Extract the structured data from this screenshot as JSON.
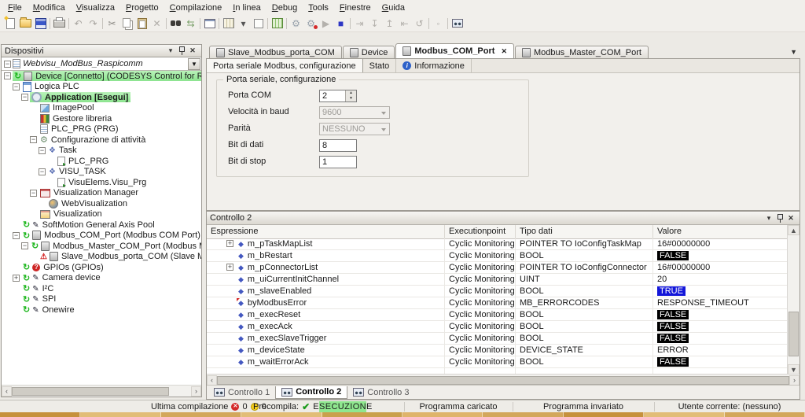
{
  "menu": {
    "items": [
      "File",
      "Modifica",
      "Visualizza",
      "Progetto",
      "Compilazione",
      "In linea",
      "Debug",
      "Tools",
      "Finestre",
      "Guida"
    ]
  },
  "toolbar": {
    "icons": [
      "new-file-icon",
      "open-folder-icon",
      "save-icon",
      "|",
      "print-icon",
      "|",
      "undo-icon",
      "redo-icon",
      "|",
      "cut-icon",
      "copy-icon",
      "paste-icon",
      "delete-icon",
      "|",
      "find-icon",
      "search-replace-icon",
      "|",
      "project-window-icon",
      "|",
      "visualization-grid-icon",
      "dropdown-arrow-icon",
      "new-object-icon",
      "|",
      "build-icon",
      "|",
      "login-icon",
      "logout-icon",
      "run-icon",
      "stop-icon",
      "|",
      "step-over-icon",
      "step-into-icon",
      "step-out-icon",
      "step-return-icon",
      "reset-icon",
      "|",
      "breakpoint-icon",
      "|",
      "watch-list-icon"
    ]
  },
  "devices_panel": {
    "title": "Dispositivi",
    "root": {
      "label": "Webvisu_ModBus_Raspicomm"
    },
    "tree": [
      {
        "label": "Device [Connetto] (CODESYS Control for Raspberry Pi)",
        "level": 1,
        "expander": "minus",
        "icons": [
          "refresh-icon",
          "device-icon"
        ],
        "highlight": true,
        "bold": false
      },
      {
        "label": "Logica PLC",
        "level": 2,
        "expander": "minus",
        "icons": [
          "plc-logic-icon"
        ]
      },
      {
        "label": "Application [Esegui]",
        "level": 3,
        "expander": "minus",
        "icons": [
          "application-icon"
        ],
        "highlight": true,
        "bold": true
      },
      {
        "label": "ImagePool",
        "level": 4,
        "expander": null,
        "icons": [
          "image-pool-icon"
        ]
      },
      {
        "label": "Gestore libreria",
        "level": 4,
        "expander": null,
        "icons": [
          "library-icon"
        ]
      },
      {
        "label": "PLC_PRG (PRG)",
        "level": 4,
        "expander": null,
        "icons": [
          "pou-icon"
        ]
      },
      {
        "label": "Configurazione di attività",
        "level": 4,
        "expander": "minus",
        "icons": [
          "task-config-icon"
        ]
      },
      {
        "label": "Task",
        "level": 5,
        "expander": "minus",
        "icons": [
          "task-icon"
        ]
      },
      {
        "label": "PLC_PRG",
        "level": 6,
        "expander": null,
        "icons": [
          "pou-call-icon"
        ]
      },
      {
        "label": "VISU_TASK",
        "level": 5,
        "expander": "minus",
        "icons": [
          "task-icon"
        ]
      },
      {
        "label": "VisuElems.Visu_Prg",
        "level": 6,
        "expander": null,
        "icons": [
          "pou-call-icon"
        ]
      },
      {
        "label": "Visualization Manager",
        "level": 4,
        "expander": "minus",
        "icons": [
          "visu-manager-icon"
        ]
      },
      {
        "label": "WebVisualization",
        "level": 5,
        "expander": null,
        "icons": [
          "webvisu-icon"
        ]
      },
      {
        "label": "Visualization",
        "level": 4,
        "expander": null,
        "icons": [
          "visu-icon"
        ]
      },
      {
        "label": "SoftMotion General Axis Pool",
        "level": 2,
        "expander": null,
        "icons": [
          "refresh-icon",
          "driver-icon"
        ]
      },
      {
        "label": "Modbus_COM_Port (Modbus COM Port)",
        "level": 2,
        "expander": "minus",
        "icons": [
          "refresh-icon",
          "device-icon"
        ]
      },
      {
        "label": "Modbus_Master_COM_Port (Modbus Master, C",
        "level": 3,
        "expander": "minus",
        "icons": [
          "refresh-icon",
          "device-icon"
        ]
      },
      {
        "label": "Slave_Modbus_porta_COM (Slave Modbus,",
        "level": 4,
        "expander": null,
        "icons": [
          "warning-icon",
          "device-icon"
        ]
      },
      {
        "label": "GPIOs (GPIOs)",
        "level": 2,
        "expander": null,
        "icons": [
          "refresh-icon",
          "gpio-error-icon"
        ]
      },
      {
        "label": "Camera device",
        "level": 2,
        "expander": "plus",
        "icons": [
          "refresh-icon",
          "driver-icon"
        ]
      },
      {
        "label": "I²C",
        "level": 2,
        "expander": null,
        "icons": [
          "refresh-icon",
          "driver-icon"
        ]
      },
      {
        "label": "SPI",
        "level": 2,
        "expander": null,
        "icons": [
          "refresh-icon",
          "driver-icon"
        ]
      },
      {
        "label": "Onewire",
        "level": 2,
        "expander": null,
        "icons": [
          "refresh-icon",
          "driver-icon"
        ]
      }
    ]
  },
  "editor": {
    "doc_tabs": [
      {
        "label": "Slave_Modbus_porta_COM",
        "active": false,
        "closable": false
      },
      {
        "label": "Device",
        "active": false,
        "closable": false
      },
      {
        "label": "Modbus_COM_Port",
        "active": true,
        "closable": true
      },
      {
        "label": "Modbus_Master_COM_Port",
        "active": false,
        "closable": false
      }
    ],
    "sub_tabs": [
      {
        "label": "Porta seriale Modbus, configurazione",
        "active": true,
        "icon": null
      },
      {
        "label": "Stato",
        "active": false,
        "icon": null
      },
      {
        "label": "Informazione",
        "active": false,
        "icon": "info-icon"
      }
    ],
    "form": {
      "legend": "Porta seriale, configurazione",
      "fields": [
        {
          "label": "Porta COM",
          "value": "2",
          "control": "spinner",
          "enabled": true
        },
        {
          "label": "Velocità in baud",
          "value": "9600",
          "control": "select",
          "enabled": false
        },
        {
          "label": "Parità",
          "value": "NESSUNO",
          "control": "select",
          "enabled": false
        },
        {
          "label": "Bit di dati",
          "value": "8",
          "control": "input",
          "enabled": true
        },
        {
          "label": "Bit di stop",
          "value": "1",
          "control": "input",
          "enabled": true
        }
      ]
    }
  },
  "watch_panel": {
    "title": "Controllo 2",
    "columns": [
      "Espressione",
      "Executionpoint",
      "Tipo dati",
      "Valore"
    ],
    "rows": [
      {
        "expression": "m_pTaskMapList",
        "executionpoint": "Cyclic Monitoring",
        "type": "POINTER TO IoConfigTaskMap",
        "value": "16#00000000",
        "value_style": "plain",
        "expandable": true,
        "flagged": false
      },
      {
        "expression": "m_bRestart",
        "executionpoint": "Cyclic Monitoring",
        "type": "BOOL",
        "value": "FALSE",
        "value_style": "false",
        "expandable": false,
        "flagged": false
      },
      {
        "expression": "m_pConnectorList",
        "executionpoint": "Cyclic Monitoring",
        "type": "POINTER TO IoConfigConnector",
        "value": "16#00000000",
        "value_style": "plain",
        "expandable": true,
        "flagged": false
      },
      {
        "expression": "m_uiCurrentInitChannel",
        "executionpoint": "Cyclic Monitoring",
        "type": "UINT",
        "value": "20",
        "value_style": "plain",
        "expandable": false,
        "flagged": false
      },
      {
        "expression": "m_slaveEnabled",
        "executionpoint": "Cyclic Monitoring",
        "type": "BOOL",
        "value": "TRUE",
        "value_style": "true",
        "expandable": false,
        "flagged": false
      },
      {
        "expression": "byModbusError",
        "executionpoint": "Cyclic Monitoring",
        "type": "MB_ERRORCODES",
        "value": "RESPONSE_TIMEOUT",
        "value_style": "plain",
        "expandable": false,
        "flagged": true
      },
      {
        "expression": "m_execReset",
        "executionpoint": "Cyclic Monitoring",
        "type": "BOOL",
        "value": "FALSE",
        "value_style": "false",
        "expandable": false,
        "flagged": false
      },
      {
        "expression": "m_execAck",
        "executionpoint": "Cyclic Monitoring",
        "type": "BOOL",
        "value": "FALSE",
        "value_style": "false",
        "expandable": false,
        "flagged": false
      },
      {
        "expression": "m_execSlaveTrigger",
        "executionpoint": "Cyclic Monitoring",
        "type": "BOOL",
        "value": "FALSE",
        "value_style": "false",
        "expandable": false,
        "flagged": false
      },
      {
        "expression": "m_deviceState",
        "executionpoint": "Cyclic Monitoring",
        "type": "DEVICE_STATE",
        "value": "ERROR",
        "value_style": "plain",
        "expandable": false,
        "flagged": false
      },
      {
        "expression": "m_waitErrorAck",
        "executionpoint": "Cyclic Monitoring",
        "type": "BOOL",
        "value": "FALSE",
        "value_style": "false",
        "expandable": false,
        "flagged": false
      }
    ],
    "tabs": [
      {
        "label": "Controllo 1",
        "active": false
      },
      {
        "label": "Controllo 2",
        "active": true
      },
      {
        "label": "Controllo 3",
        "active": false
      }
    ]
  },
  "status_bar": {
    "last_build_label": "Ultima compilazione",
    "error_count": "0",
    "warning_count": "0",
    "precompile_label": "Precompila:",
    "run_state": "ESECUZIONE",
    "program_loaded": "Programma caricato",
    "program_unchanged": "Programma invariato",
    "current_user": "Utente corrente: (nessuno)"
  },
  "taskbar_strip": {
    "segments": [
      "#c6913c",
      "#e2bd77",
      "#d3a75b",
      "#e2bd77",
      "#caa04c",
      "#dfb46a",
      "#d3a75b",
      "#c6913c",
      "#e2bd77",
      "#d3a75b"
    ]
  },
  "colors": {
    "selection_green": "#97e89b",
    "value_true_bg": "#1316d9",
    "value_false_bg": "#000000",
    "run_badge_bg": "#8fe78f"
  }
}
